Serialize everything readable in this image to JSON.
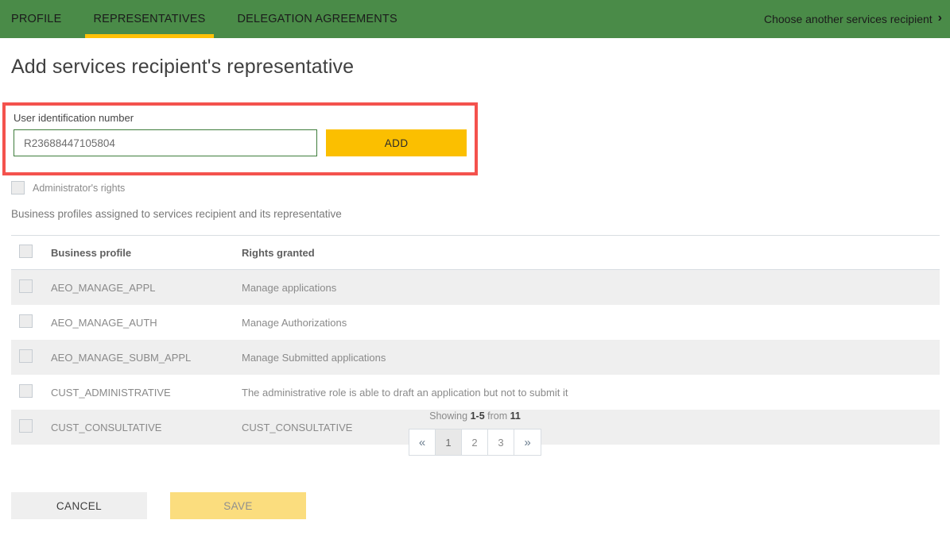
{
  "topbar": {
    "tabs": [
      {
        "label": "PROFILE",
        "active": false
      },
      {
        "label": "REPRESENTATIVES",
        "active": true
      },
      {
        "label": "DELEGATION AGREEMENTS",
        "active": false
      }
    ],
    "recipient_link": "Choose another services recipient",
    "chevron": "›",
    "background_color": "#4a8b48",
    "accent_color": "#ffc107"
  },
  "page": {
    "title": "Add services recipient's representative"
  },
  "identification": {
    "field_label": "User identification number",
    "input_value": "R23688447105804",
    "input_placeholder": "",
    "add_label": "ADD",
    "highlight_color": "#f4524d",
    "add_button_color": "#fbbf00"
  },
  "admin": {
    "checkbox_label": "Administrator's rights",
    "checked": false
  },
  "profiles_section": {
    "subtitle": "Business profiles assigned to services recipient and its representative",
    "columns": [
      "",
      "Business profile",
      "Rights granted"
    ],
    "rows": [
      {
        "checked": false,
        "profile": "AEO_MANAGE_APPL",
        "rights": "Manage applications"
      },
      {
        "checked": false,
        "profile": "AEO_MANAGE_AUTH",
        "rights": "Manage Authorizations"
      },
      {
        "checked": false,
        "profile": "AEO_MANAGE_SUBM_APPL",
        "rights": "Manage Submitted applications"
      },
      {
        "checked": false,
        "profile": "CUST_ADMINISTRATIVE",
        "rights": "The administrative role is able to draft an application but not to submit it"
      },
      {
        "checked": false,
        "profile": "CUST_CONSULTATIVE",
        "rights": "CUST_CONSULTATIVE"
      }
    ]
  },
  "pagination": {
    "showing_prefix": "Showing",
    "range": "1-5",
    "middle": "from",
    "total": "11",
    "first_label": "«",
    "last_label": "»",
    "pages": [
      "1",
      "2",
      "3"
    ],
    "current_page": "1"
  },
  "footer": {
    "cancel_label": "CANCEL",
    "save_label": "SAVE",
    "save_disabled": true
  }
}
